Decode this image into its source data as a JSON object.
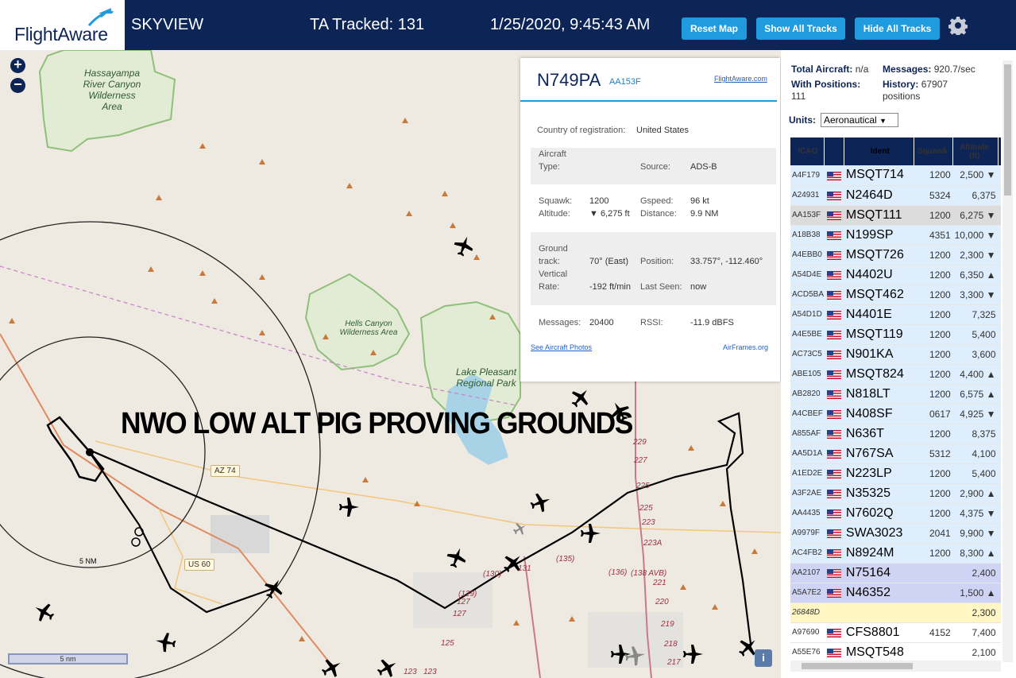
{
  "header": {
    "logo_text": "FlightAware",
    "app_title": "SKYVIEW",
    "ta_tracked": "TA Tracked: 131",
    "clock": "1/25/2020, 9:45:43 AM",
    "reset_label": "Reset Map",
    "show_label": "Show All Tracks",
    "hide_label": "Hide All Tracks",
    "icon": "gear-icon"
  },
  "map": {
    "zoom_in": "+",
    "zoom_out": "−",
    "overlay_text": "NWO LOW ALT PIG PROVING GROUNDS",
    "labels": {
      "hassayampa": "Hassayampa River Canyon Wilderness Area",
      "hells_canyon": "Hells Canyon Wilderness Area",
      "lake_pleasant": "Lake Pleasant Regional Park",
      "az74": "AZ 74",
      "us60": "US 60"
    },
    "route_numbers": [
      "229",
      "227",
      "225",
      "225",
      "223",
      "223A",
      "221",
      "220",
      "219",
      "218",
      "217",
      "(135)",
      "(136)",
      "(138 AVB)",
      "(130)",
      "131",
      "(129)",
      "127",
      "125",
      "127",
      "123",
      "123"
    ],
    "range_label": "5 NM",
    "scale_label": "5 nm",
    "info": "i"
  },
  "popup": {
    "registration": "N749PA",
    "icao": "AA153F",
    "fa_link": "FlightAware.com",
    "country_label": "Country of registration:",
    "country": "United States",
    "aircraft_type_label_1": "Aircraft",
    "aircraft_type_label_2": "Type:",
    "aircraft_type": "",
    "source_label": "Source:",
    "source": "ADS-B",
    "squawk_label": "Squawk:",
    "squawk": "1200",
    "altitude_label": "Altitude:",
    "altitude": "▼ 6,275 ft",
    "gspeed_label": "Gspeed:",
    "gspeed": "96 kt",
    "distance_label": "Distance:",
    "distance": "9.9 NM",
    "ground_label_1": "Ground",
    "ground_label_2": "track:",
    "ground_track": "70° (East)",
    "position_label": "Position:",
    "position": "33.757°, -112.460°",
    "vertical_label_1": "Vertical",
    "vertical_label_2": "Rate:",
    "vertical_rate": "-192 ft/min",
    "last_seen_label": "Last Seen:",
    "last_seen": "now",
    "messages_label": "Messages:",
    "messages": "20400",
    "rssi_label": "RSSI:",
    "rssi": "-11.9 dBFS",
    "photos_link": "See Aircraft Photos",
    "airframes_link": "AirFrames.org"
  },
  "panel": {
    "total_label": "Total Aircraft:",
    "total_value": "n/a",
    "messages_label": "Messages:",
    "messages_value": "920.7/sec",
    "with_pos_label": "With Positions:",
    "with_pos_value": "111",
    "history_label": "History:",
    "history_value_1": "67907",
    "history_value_2": "positions",
    "units_label": "Units:",
    "units_value": "Aeronautical",
    "columns": [
      "ICAO",
      "",
      "Ident",
      "Squawk",
      "Altitude (ft)"
    ],
    "rows": [
      {
        "icao": "A4F179",
        "flag": true,
        "ident": "MSQT714",
        "squawk": "1200",
        "alt": "2,500 ▼",
        "type": "ads"
      },
      {
        "icao": "A24931",
        "flag": true,
        "ident": "N2464D",
        "squawk": "5324",
        "alt": "6,375",
        "type": "ads"
      },
      {
        "icao": "AA153F",
        "flag": true,
        "ident": "MSQT111",
        "squawk": "1200",
        "alt": "6,275 ▼",
        "type": "sel"
      },
      {
        "icao": "A18B38",
        "flag": true,
        "ident": "N199SP",
        "squawk": "4351",
        "alt": "10,000 ▼",
        "type": "ads"
      },
      {
        "icao": "A4EBB0",
        "flag": true,
        "ident": "MSQT726",
        "squawk": "1200",
        "alt": "2,300 ▼",
        "type": "ads"
      },
      {
        "icao": "A54D4E",
        "flag": true,
        "ident": "N4402U",
        "squawk": "1200",
        "alt": "6,350 ▲",
        "type": "ads"
      },
      {
        "icao": "ACD5BA",
        "flag": true,
        "ident": "MSQT462",
        "squawk": "1200",
        "alt": "3,300 ▼",
        "type": "ads"
      },
      {
        "icao": "A54D1D",
        "flag": true,
        "ident": "N4401E",
        "squawk": "1200",
        "alt": "7,325",
        "type": "ads"
      },
      {
        "icao": "A4E5BE",
        "flag": true,
        "ident": "MSQT119",
        "squawk": "1200",
        "alt": "5,400",
        "type": "ads"
      },
      {
        "icao": "AC73C5",
        "flag": true,
        "ident": "N901KA",
        "squawk": "1200",
        "alt": "3,600",
        "type": "ads"
      },
      {
        "icao": "ABE105",
        "flag": true,
        "ident": "MSQT824",
        "squawk": "1200",
        "alt": "4,400 ▲",
        "type": "ads"
      },
      {
        "icao": "AB2820",
        "flag": true,
        "ident": "N818LT",
        "squawk": "1200",
        "alt": "6,575 ▲",
        "type": "ads"
      },
      {
        "icao": "A4CBEF",
        "flag": true,
        "ident": "N408SF",
        "squawk": "0617",
        "alt": "4,925 ▼",
        "type": "ads"
      },
      {
        "icao": "A855AF",
        "flag": true,
        "ident": "N636T",
        "squawk": "1200",
        "alt": "8,375",
        "type": "ads"
      },
      {
        "icao": "AA5D1A",
        "flag": true,
        "ident": "N767SA",
        "squawk": "5312",
        "alt": "4,100",
        "type": "ads"
      },
      {
        "icao": "A1ED2E",
        "flag": true,
        "ident": "N223LP",
        "squawk": "1200",
        "alt": "5,400",
        "type": "ads"
      },
      {
        "icao": "A3F2AE",
        "flag": true,
        "ident": "N35325",
        "squawk": "1200",
        "alt": "2,900 ▲",
        "type": "ads"
      },
      {
        "icao": "AA4435",
        "flag": true,
        "ident": "N7602Q",
        "squawk": "1200",
        "alt": "4,375 ▼",
        "type": "ads"
      },
      {
        "icao": "A9979F",
        "flag": true,
        "ident": "SWA3023",
        "squawk": "2041",
        "alt": "9,900 ▼",
        "type": "ads"
      },
      {
        "icao": "AC4FB2",
        "flag": true,
        "ident": "N8924M",
        "squawk": "1200",
        "alt": "8,300 ▲",
        "type": "ads"
      },
      {
        "icao": "AA2107",
        "flag": true,
        "ident": "N75164",
        "squawk": "",
        "alt": "2,400",
        "type": "mlat"
      },
      {
        "icao": "A5A7E2",
        "flag": true,
        "ident": "N46352",
        "squawk": "",
        "alt": "1,500 ▲",
        "type": "mlat"
      },
      {
        "icao": "26848D",
        "flag": false,
        "ident": "",
        "squawk": "",
        "alt": "2,300",
        "type": "other"
      },
      {
        "icao": "A97690",
        "flag": true,
        "ident": "CFS8801",
        "squawk": "4152",
        "alt": "7,400",
        "type": "plain"
      },
      {
        "icao": "A55E76",
        "flag": true,
        "ident": "MSQT548",
        "squawk": "",
        "alt": "2,100",
        "type": "plain"
      }
    ]
  },
  "colors": {
    "header_bg": "#0d2456",
    "button_bg": "#1f9bde",
    "ads_row": "#dfeefd",
    "mlat_row": "#d0d4f4",
    "other_row": "#fff6c4"
  }
}
